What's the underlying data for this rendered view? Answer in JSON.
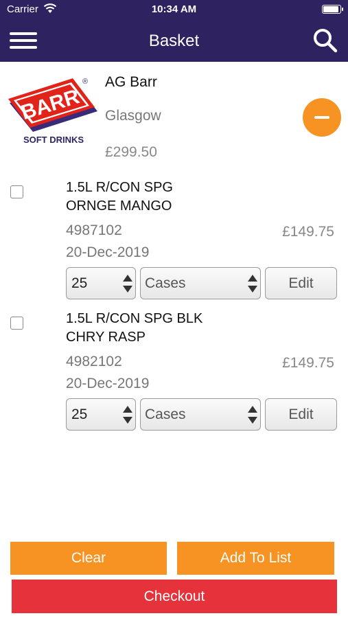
{
  "status_bar": {
    "carrier": "Carrier",
    "time": "10:34 AM"
  },
  "header": {
    "title": "Basket",
    "menu_icon": "hamburger-menu-icon",
    "search_icon": "search-icon"
  },
  "supplier": {
    "logo_brand": "BARR",
    "logo_registered": "®",
    "logo_tagline": "SOFT DRINKS",
    "name": "AG Barr",
    "city": "Glasgow",
    "total": "£299.50",
    "remove_icon": "minus-circle-icon"
  },
  "items": [
    {
      "line1": "1.5L R/CON SPG",
      "line2": "ORNGE MANGO",
      "code": "4987102",
      "date": "20-Dec-2019",
      "price": "£149.75",
      "quantity": "25",
      "unit": "Cases",
      "edit_label": "Edit"
    },
    {
      "line1": "1.5L R/CON SPG BLK",
      "line2": "CHRY RASP",
      "code": "4982102",
      "date": "20-Dec-2019",
      "price": "£149.75",
      "quantity": "25",
      "unit": "Cases",
      "edit_label": "Edit"
    }
  ],
  "actions": {
    "clear": "Clear",
    "add_to_list": "Add To List",
    "checkout": "Checkout"
  },
  "colors": {
    "header": "#2e2360",
    "accent_orange": "#f69322",
    "checkout_red": "#e6323a"
  }
}
